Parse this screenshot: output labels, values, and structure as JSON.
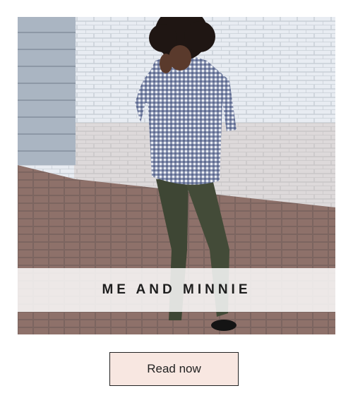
{
  "card": {
    "image_alt": "woman in gingham shirt and olive pants standing by a brick wall",
    "caption": "ME AND MINNIE",
    "button_label": "Read now"
  },
  "colors": {
    "caption_band": "#ffffff",
    "button_background": "#f8e7e1",
    "button_border": "#222222",
    "caption_text": "#1e1e1e"
  }
}
